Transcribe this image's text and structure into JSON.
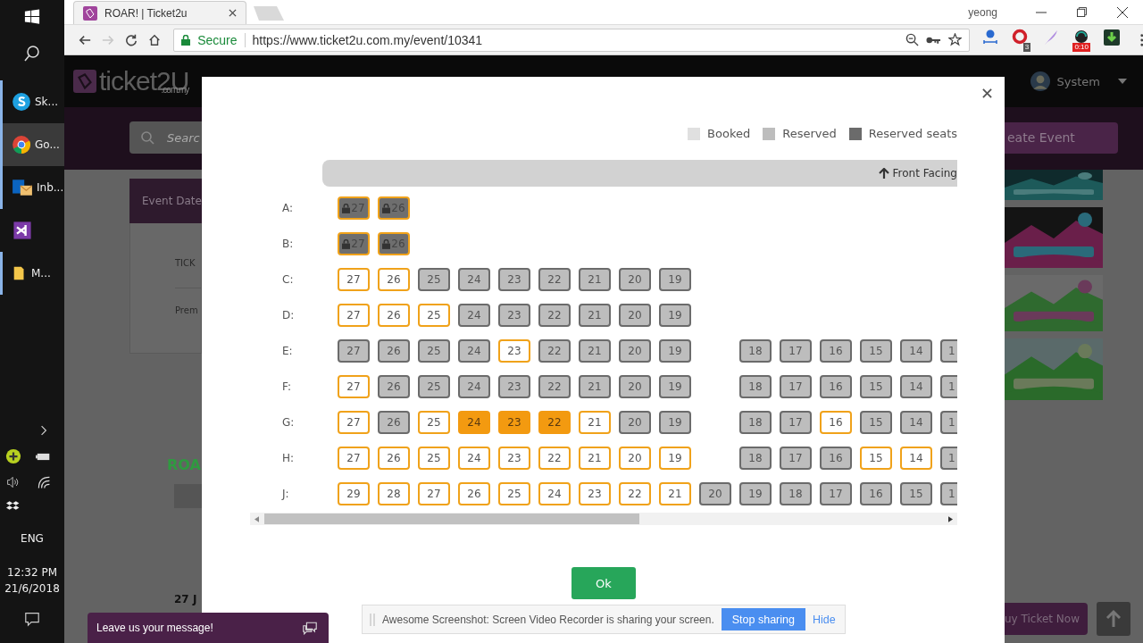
{
  "taskbar": {
    "items": [
      {
        "kind": "skype",
        "label": "Sk...",
        "selected": false,
        "running": true
      },
      {
        "kind": "chrome",
        "label": "Go...",
        "selected": true,
        "running": true
      },
      {
        "kind": "outlook",
        "label": "Inb...",
        "selected": false,
        "running": true
      },
      {
        "kind": "studio",
        "selected": false,
        "running": false
      },
      {
        "kind": "folder",
        "label": "M...",
        "selected": false,
        "running": true
      }
    ],
    "language": "ENG",
    "time": "12:32 PM",
    "date": "21/6/2018"
  },
  "browser": {
    "tab": {
      "title": "ROAR! | Ticket2u"
    },
    "profile": "yeong",
    "nav_buttons": [
      {
        "kind": "back",
        "disabled": false
      },
      {
        "kind": "forward",
        "disabled": true
      },
      {
        "kind": "reload",
        "disabled": false
      },
      {
        "kind": "home",
        "disabled": false
      }
    ],
    "security": "Secure",
    "url": "https://www.ticket2u.com.my/event/10341",
    "extensions": [
      {
        "kind": "translate"
      },
      {
        "kind": "opera",
        "badge": "3"
      },
      {
        "kind": "feather"
      },
      {
        "kind": "recorder",
        "badge": "0:10"
      },
      {
        "kind": "download"
      }
    ]
  },
  "site": {
    "logo": "ticket2U",
    "logo_suffix": ".com.my",
    "user": "System",
    "search": {
      "placeholder": "Searc"
    },
    "create_button": "eate Event",
    "event_table": {
      "header": "Event Date",
      "rows": [
        "TICK",
        "Prem"
      ]
    },
    "section_title": "ROA",
    "date_cell": "27 J",
    "buy_button": "uy Ticket Now"
  },
  "seat_modal": {
    "legend": [
      {
        "label": "Booked",
        "color": "#e0e0e0"
      },
      {
        "label": "Reserved",
        "color": "#bdbdbd"
      },
      {
        "label": "Reserved seats",
        "color": "#6b6b6b"
      }
    ],
    "front_label": "Front Facing",
    "rows": [
      {
        "label": "A:",
        "blocks": [
          [
            {
              "number": "27",
              "kind": "locked"
            },
            {
              "number": "26",
              "kind": "locked"
            }
          ]
        ]
      },
      {
        "label": "B:",
        "blocks": [
          [
            {
              "number": "27",
              "kind": "locked"
            },
            {
              "number": "26",
              "kind": "locked"
            }
          ]
        ]
      },
      {
        "label": "C:",
        "blocks": [
          [
            {
              "number": "27",
              "kind": "available"
            },
            {
              "number": "26",
              "kind": "available"
            },
            {
              "number": "25",
              "kind": "taken"
            },
            {
              "number": "24",
              "kind": "taken"
            },
            {
              "number": "23",
              "kind": "taken"
            },
            {
              "number": "22",
              "kind": "taken"
            },
            {
              "number": "21",
              "kind": "taken"
            },
            {
              "number": "20",
              "kind": "taken"
            },
            {
              "number": "19",
              "kind": "taken"
            }
          ]
        ]
      },
      {
        "label": "D:",
        "blocks": [
          [
            {
              "number": "27",
              "kind": "available"
            },
            {
              "number": "26",
              "kind": "available"
            },
            {
              "number": "25",
              "kind": "available"
            },
            {
              "number": "24",
              "kind": "taken"
            },
            {
              "number": "23",
              "kind": "taken"
            },
            {
              "number": "22",
              "kind": "taken"
            },
            {
              "number": "21",
              "kind": "taken"
            },
            {
              "number": "20",
              "kind": "taken"
            },
            {
              "number": "19",
              "kind": "taken"
            }
          ]
        ]
      },
      {
        "label": "E:",
        "blocks": [
          [
            {
              "number": "27",
              "kind": "taken"
            },
            {
              "number": "26",
              "kind": "taken"
            },
            {
              "number": "25",
              "kind": "taken"
            },
            {
              "number": "24",
              "kind": "taken"
            },
            {
              "number": "23",
              "kind": "available"
            },
            {
              "number": "22",
              "kind": "taken"
            },
            {
              "number": "21",
              "kind": "taken"
            },
            {
              "number": "20",
              "kind": "taken"
            },
            {
              "number": "19",
              "kind": "taken"
            }
          ],
          [
            {
              "number": "18",
              "kind": "taken"
            },
            {
              "number": "17",
              "kind": "taken"
            },
            {
              "number": "16",
              "kind": "taken"
            },
            {
              "number": "15",
              "kind": "taken"
            },
            {
              "number": "14",
              "kind": "taken"
            },
            {
              "number": "1",
              "kind": "taken",
              "partial": true
            }
          ]
        ]
      },
      {
        "label": "F:",
        "blocks": [
          [
            {
              "number": "27",
              "kind": "available"
            },
            {
              "number": "26",
              "kind": "taken"
            },
            {
              "number": "25",
              "kind": "taken"
            },
            {
              "number": "24",
              "kind": "taken"
            },
            {
              "number": "23",
              "kind": "taken"
            },
            {
              "number": "22",
              "kind": "taken"
            },
            {
              "number": "21",
              "kind": "taken"
            },
            {
              "number": "20",
              "kind": "taken"
            },
            {
              "number": "19",
              "kind": "taken"
            }
          ],
          [
            {
              "number": "18",
              "kind": "taken"
            },
            {
              "number": "17",
              "kind": "taken"
            },
            {
              "number": "16",
              "kind": "taken"
            },
            {
              "number": "15",
              "kind": "taken"
            },
            {
              "number": "14",
              "kind": "taken"
            },
            {
              "number": "1",
              "kind": "taken",
              "partial": true
            }
          ]
        ]
      },
      {
        "label": "G:",
        "blocks": [
          [
            {
              "number": "27",
              "kind": "available"
            },
            {
              "number": "26",
              "kind": "taken"
            },
            {
              "number": "25",
              "kind": "available"
            },
            {
              "number": "24",
              "kind": "selected"
            },
            {
              "number": "23",
              "kind": "selected"
            },
            {
              "number": "22",
              "kind": "selected"
            },
            {
              "number": "21",
              "kind": "available"
            },
            {
              "number": "20",
              "kind": "taken"
            },
            {
              "number": "19",
              "kind": "taken"
            }
          ],
          [
            {
              "number": "18",
              "kind": "taken"
            },
            {
              "number": "17",
              "kind": "taken"
            },
            {
              "number": "16",
              "kind": "available"
            },
            {
              "number": "15",
              "kind": "taken"
            },
            {
              "number": "14",
              "kind": "taken"
            },
            {
              "number": "1",
              "kind": "taken",
              "partial": true
            }
          ]
        ]
      },
      {
        "label": "H:",
        "blocks": [
          [
            {
              "number": "27",
              "kind": "available"
            },
            {
              "number": "26",
              "kind": "available"
            },
            {
              "number": "25",
              "kind": "available"
            },
            {
              "number": "24",
              "kind": "available"
            },
            {
              "number": "23",
              "kind": "available"
            },
            {
              "number": "22",
              "kind": "available"
            },
            {
              "number": "21",
              "kind": "available"
            },
            {
              "number": "20",
              "kind": "available"
            },
            {
              "number": "19",
              "kind": "available"
            }
          ],
          [
            {
              "number": "18",
              "kind": "taken"
            },
            {
              "number": "17",
              "kind": "taken"
            },
            {
              "number": "16",
              "kind": "taken"
            },
            {
              "number": "15",
              "kind": "available"
            },
            {
              "number": "14",
              "kind": "available"
            },
            {
              "number": "1",
              "kind": "taken",
              "partial": true
            }
          ]
        ]
      },
      {
        "label": "J:",
        "blocks": [
          [
            {
              "number": "29",
              "kind": "available"
            },
            {
              "number": "28",
              "kind": "available"
            },
            {
              "number": "27",
              "kind": "available"
            },
            {
              "number": "26",
              "kind": "available"
            },
            {
              "number": "25",
              "kind": "available"
            },
            {
              "number": "24",
              "kind": "available"
            },
            {
              "number": "23",
              "kind": "available"
            },
            {
              "number": "22",
              "kind": "available"
            },
            {
              "number": "21",
              "kind": "available"
            },
            {
              "number": "20",
              "kind": "taken"
            },
            {
              "number": "19",
              "kind": "taken"
            },
            {
              "number": "18",
              "kind": "taken"
            },
            {
              "number": "17",
              "kind": "taken"
            },
            {
              "number": "16",
              "kind": "taken"
            },
            {
              "number": "15",
              "kind": "taken"
            },
            {
              "number": "1",
              "kind": "taken",
              "partial": true
            }
          ]
        ]
      }
    ],
    "ok_button": "Ok"
  },
  "chat_bar": {
    "label": "Leave us your message!"
  },
  "share_bar": {
    "message": "Awesome Screenshot: Screen Video Recorder is sharing your screen.",
    "stop_button": "Stop sharing",
    "hide_link": "Hide"
  }
}
